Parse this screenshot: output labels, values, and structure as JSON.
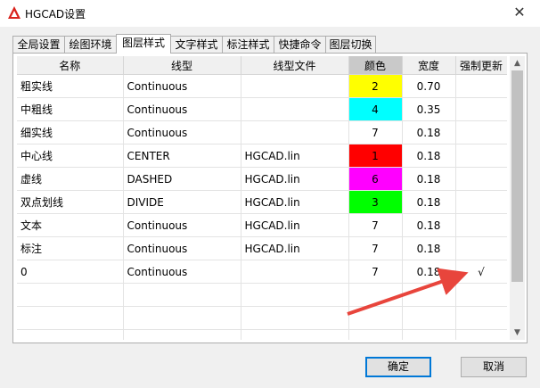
{
  "window": {
    "title": "HGCAD设置",
    "close_symbol": "✕"
  },
  "tabs": [
    "全局设置",
    "绘图环境",
    "图层样式",
    "文字样式",
    "标注样式",
    "快捷命令",
    "图层切换"
  ],
  "active_tab_index": 2,
  "grid": {
    "columns": [
      "名称",
      "线型",
      "线型文件",
      "颜色",
      "宽度",
      "强制更新"
    ],
    "rows": [
      {
        "name": "粗实线",
        "linetype": "Continuous",
        "file": "",
        "color": "2",
        "color_bg": "#ffff00",
        "width": "0.70",
        "force": ""
      },
      {
        "name": "中粗线",
        "linetype": "Continuous",
        "file": "",
        "color": "4",
        "color_bg": "#00ffff",
        "width": "0.35",
        "force": ""
      },
      {
        "name": "细实线",
        "linetype": "Continuous",
        "file": "",
        "color": "7",
        "color_bg": "#ffffff",
        "width": "0.18",
        "force": ""
      },
      {
        "name": "中心线",
        "linetype": "CENTER",
        "file": "HGCAD.lin",
        "color": "1",
        "color_bg": "#ff0000",
        "width": "0.18",
        "force": ""
      },
      {
        "name": "虚线",
        "linetype": "DASHED",
        "file": "HGCAD.lin",
        "color": "6",
        "color_bg": "#ff00ff",
        "width": "0.18",
        "force": ""
      },
      {
        "name": "双点划线",
        "linetype": "DIVIDE",
        "file": "HGCAD.lin",
        "color": "3",
        "color_bg": "#00ff00",
        "width": "0.18",
        "force": ""
      },
      {
        "name": "文本",
        "linetype": "Continuous",
        "file": "HGCAD.lin",
        "color": "7",
        "color_bg": "#ffffff",
        "width": "0.18",
        "force": ""
      },
      {
        "name": "标注",
        "linetype": "Continuous",
        "file": "HGCAD.lin",
        "color": "7",
        "color_bg": "#ffffff",
        "width": "0.18",
        "force": ""
      },
      {
        "name": "0",
        "linetype": "Continuous",
        "file": "",
        "color": "7",
        "color_bg": "#ffffff",
        "width": "0.18",
        "force": "√"
      }
    ],
    "empty_rows": 3
  },
  "buttons": {
    "ok": "确定",
    "cancel": "取消"
  },
  "colors": {
    "annotation_arrow": "#e8453c",
    "focus": "#0078d7"
  }
}
